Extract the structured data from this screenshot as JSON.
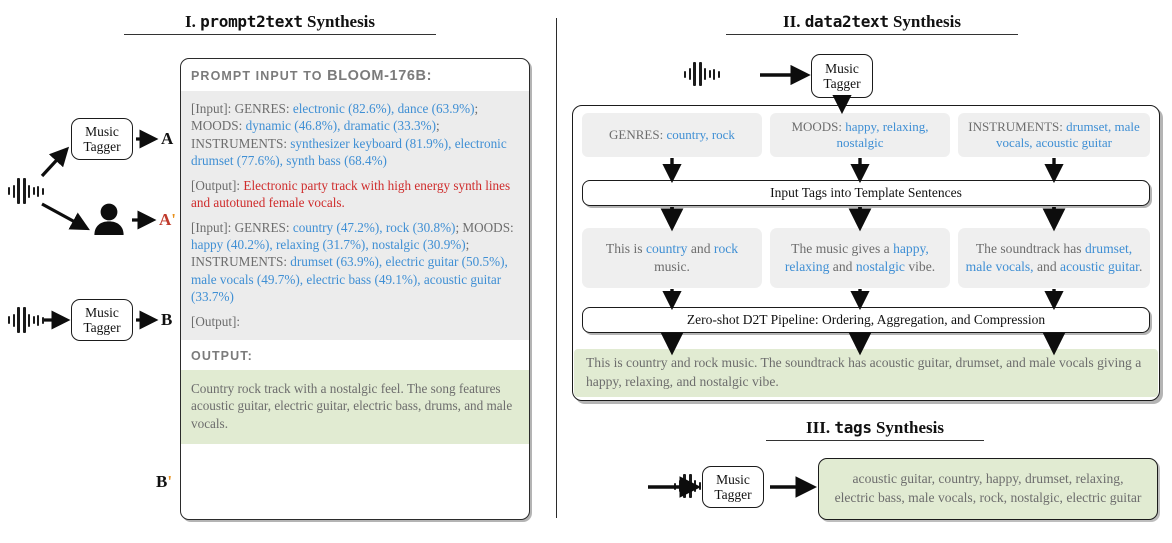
{
  "figure": {
    "divider": true
  },
  "section1": {
    "title_num": "I.",
    "title_mono": "prompt2text",
    "title_tail": "Synthesis",
    "panel_header_1": "Prompt input to",
    "panel_header_2": "BLOOM-176B:",
    "output_header": "Output:",
    "nodes": {
      "tagger_label_1": "Music",
      "tagger_label_2": "Tagger",
      "label_a": "A",
      "label_a_prime_base": "A",
      "label_a_prime_mark": "'",
      "label_b": "B",
      "label_b_prime_base": "B",
      "label_b_prime_mark": "'"
    },
    "prompt": {
      "line1_label": "[Input]: GENRES: ",
      "line1_v1": "electronic (82.6%), dance (63.9%)",
      "line1_l2": "; MOODS: ",
      "line1_v2": "dynamic (46.8%), dramatic (33.3%)",
      "line1_l3": "; INSTRUMENTS: ",
      "line1_v3": "synthesizer keyboard (81.9%), electronic drumset (77.6%), synth bass (68.4%)",
      "out1_label": "[Output]: ",
      "out1_text": "Electronic party track with high energy synth lines and autotuned female vocals.",
      "line2_label": "[Input]: GENRES: ",
      "line2_v1": "country (47.2%), rock (30.8%)",
      "line2_l2": "; MOODS: ",
      "line2_v2": "happy (40.2%), relaxing (31.7%), nostalgic (30.9%)",
      "line2_l3": "; INSTRUMENTS: ",
      "line2_v3": "drumset (63.9%), electric guitar (50.5%), male vocals (49.7%), electric bass (49.1%), acoustic guitar (33.7%)",
      "out2_label": "[Output]:",
      "final_output": "Country rock track with a nostalgic feel. The song features acoustic guitar, electric guitar, electric bass, drums, and male vocals."
    }
  },
  "section2": {
    "title_num": "II.",
    "title_mono": "data2text",
    "title_tail": "Synthesis",
    "tagger_label_1": "Music",
    "tagger_label_2": "Tagger",
    "tag_cells": [
      {
        "label": "GENRES: ",
        "value": "country, rock"
      },
      {
        "label": "MOODS: ",
        "value": "happy, relaxing, nostalgic"
      },
      {
        "label": "INSTRUMENTS: ",
        "value": "drumset, male vocals, acoustic guitar"
      }
    ],
    "template_bar": "Input Tags into Template Sentences",
    "sentences": [
      {
        "p1": "This is ",
        "b1": "country",
        "p2": " and ",
        "b2": "rock",
        "p3": " music."
      },
      {
        "p1": "The music gives a ",
        "b1": "happy, relaxing",
        "p2": " and ",
        "b2": "nostalgic",
        "p3": " vibe."
      },
      {
        "p1": "The soundtrack has ",
        "b1": "drumset, male vocals,",
        "p2": " and ",
        "b2": "acoustic guitar",
        "p3": "."
      }
    ],
    "pipeline_bar": "Zero-shot D2T Pipeline: Ordering, Aggregation, and Compression",
    "final_text": "This is country and rock music. The soundtrack has acoustic guitar, drumset, and male vocals giving a happy, relaxing, and nostalgic vibe."
  },
  "section3": {
    "title_num": "III.",
    "title_mono": "tags",
    "title_tail": "Synthesis",
    "tagger_label_1": "Music",
    "tagger_label_2": "Tagger",
    "tags_text": "acoustic guitar, country, happy, drumset, relaxing, electric bass, male vocals, rock, nostalgic, electric guitar"
  },
  "colors": {
    "blue": "#3f8fd4",
    "red": "#cf2c2c",
    "gray_text": "#6d6d6d",
    "green_bg": "#e1ebd2",
    "gray_bg": "#ececec",
    "accent_orange": "#e8911c"
  }
}
